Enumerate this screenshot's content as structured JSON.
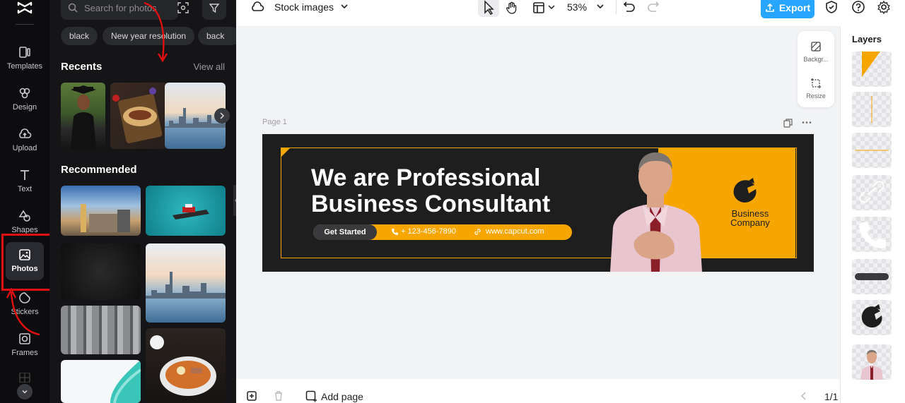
{
  "rail": {
    "items": [
      {
        "label": "Templates",
        "icon": "templates-icon"
      },
      {
        "label": "Design",
        "icon": "design-icon"
      },
      {
        "label": "Upload",
        "icon": "upload-icon"
      },
      {
        "label": "Text",
        "icon": "text-icon"
      },
      {
        "label": "Shapes",
        "icon": "shapes-icon"
      },
      {
        "label": "Photos",
        "icon": "photos-icon",
        "active": true
      },
      {
        "label": "Stickers",
        "icon": "stickers-icon"
      },
      {
        "label": "Frames",
        "icon": "frames-icon"
      }
    ]
  },
  "panel": {
    "search_placeholder": "Search for photos",
    "chips": [
      "black",
      "New year resolution",
      "back"
    ],
    "recents_title": "Recents",
    "view_all": "View all",
    "recommended_title": "Recommended"
  },
  "topbar": {
    "title": "Stock images",
    "zoom": "53%",
    "export_label": "Export"
  },
  "canvas": {
    "floating_tools": [
      "Backgr...",
      "Resize"
    ],
    "page_label": "Page 1",
    "banner": {
      "headline_line1": "We are Professional",
      "headline_line2": "Business Consultant",
      "cta": "Get Started",
      "phone": "+ 123-456-7890",
      "website": "www.capcut.com",
      "company_line1": "Business",
      "company_line2": "Company"
    }
  },
  "bottombar": {
    "add_page": "Add page",
    "pagination": "1/1"
  },
  "layers": {
    "title": "Layers"
  },
  "colors": {
    "accent_orange": "#f7a600",
    "export_blue": "#27a5ff",
    "rail_bg": "#0d0d0f",
    "panel_bg": "#151518",
    "highlight_red": "#e01010"
  }
}
